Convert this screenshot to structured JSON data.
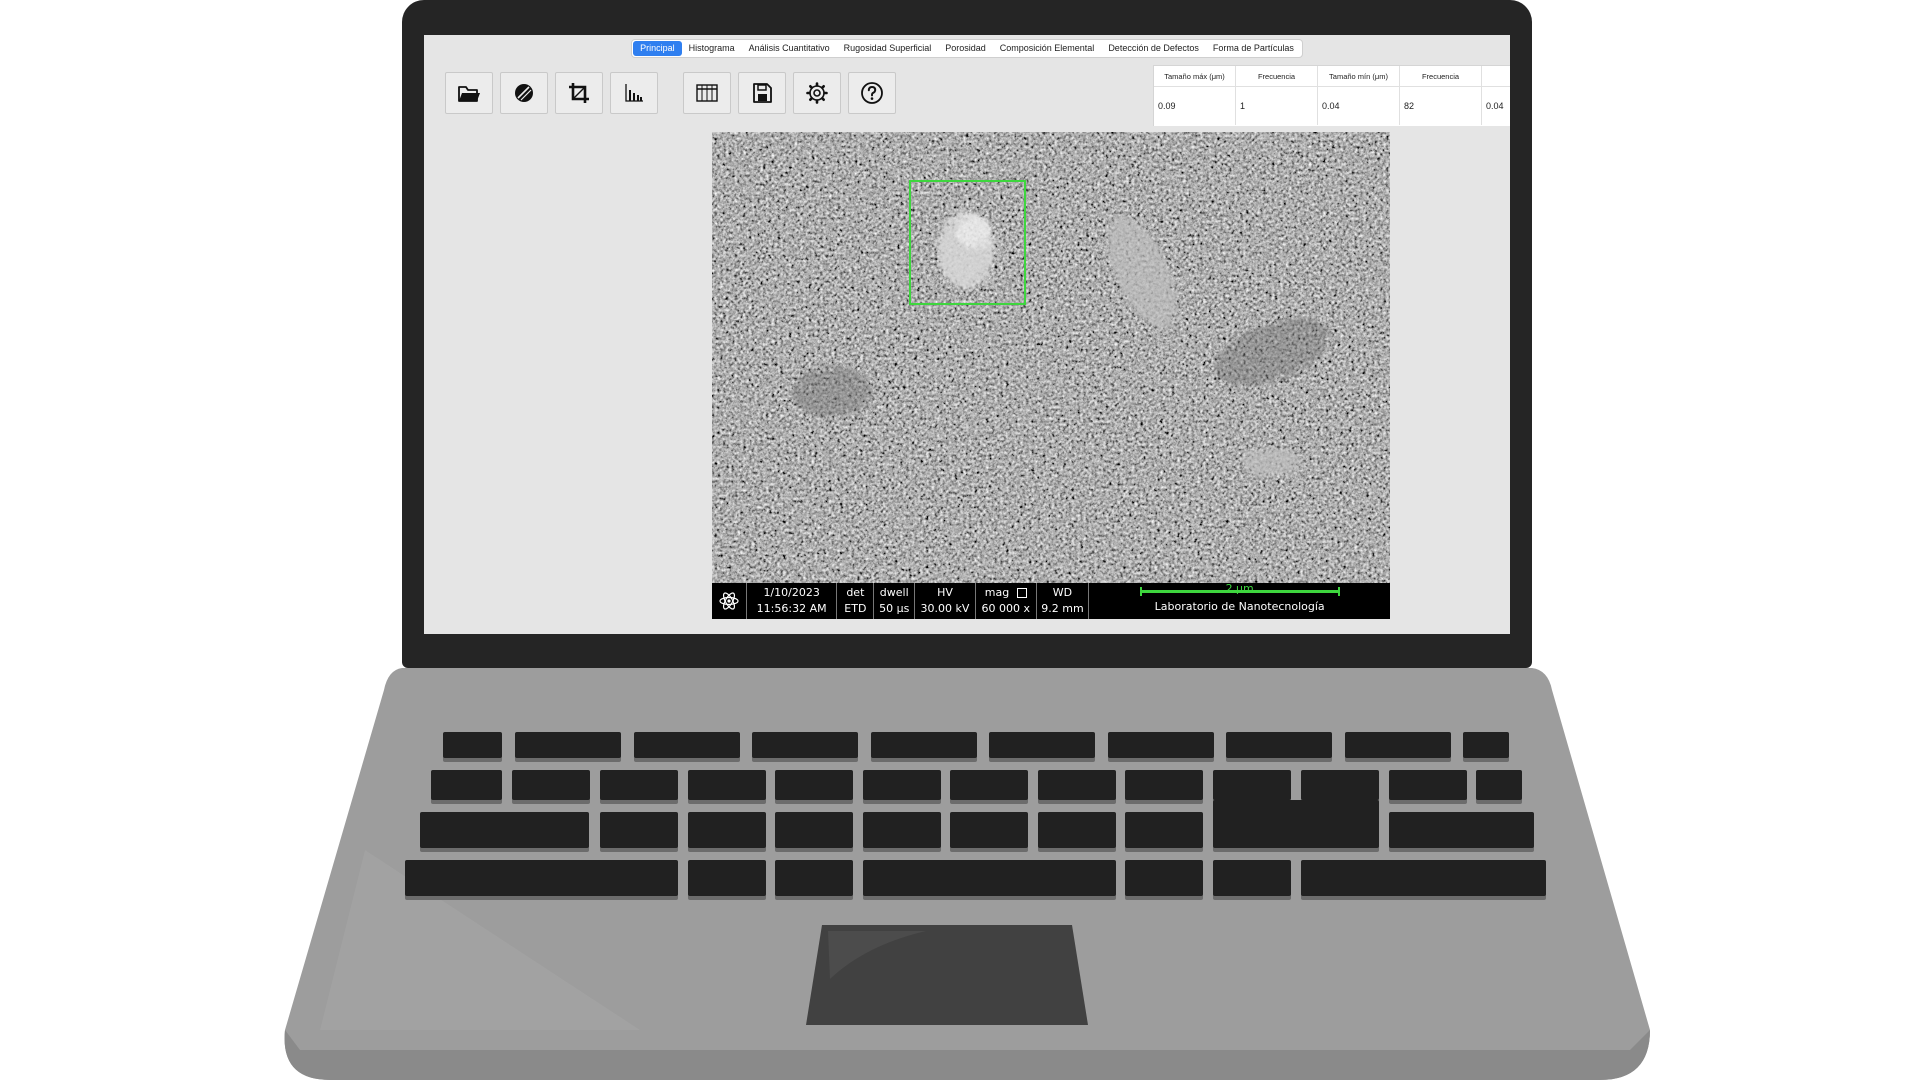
{
  "tabs": [
    {
      "label": "Principal",
      "active": true
    },
    {
      "label": "Histograma",
      "active": false
    },
    {
      "label": "Análisis Cuantitativo",
      "active": false
    },
    {
      "label": "Rugosidad Superficial",
      "active": false
    },
    {
      "label": "Porosidad",
      "active": false
    },
    {
      "label": "Composición Elemental",
      "active": false
    },
    {
      "label": "Detección de Defectos",
      "active": false
    },
    {
      "label": "Forma de Partículas",
      "active": false
    }
  ],
  "toolbar": {
    "icons": [
      "open-folder-icon",
      "filter-icon",
      "crop-icon",
      "histogram-icon",
      "table-icon",
      "save-icon",
      "settings-icon",
      "help-icon"
    ]
  },
  "results_table": {
    "headers": [
      "Tamaño máx (μm)",
      "Frecuencia",
      "Tamaño mín (μm)",
      "Frecuencia"
    ],
    "row": [
      "0.09",
      "1",
      "0.04",
      "82",
      "0.04"
    ]
  },
  "sem_info": {
    "date": "1/10/2023",
    "time": "11:56:32 AM",
    "det_label": "det",
    "det_value": "ETD",
    "dwell_label": "dwell",
    "dwell_value": "50 μs",
    "hv_label": "HV",
    "hv_value": "30.00 kV",
    "mag_label": "mag",
    "mag_value": "60 000 x",
    "wd_label": "WD",
    "wd_value": "9.2 mm",
    "scale_label": "2 μm",
    "lab_name": "Laboratorio de Nanotecnología"
  },
  "colors": {
    "accent": "#2f7ff0",
    "roi": "#3ed63e",
    "laptop_body": "#9e9e9e",
    "bezel": "#252525"
  }
}
